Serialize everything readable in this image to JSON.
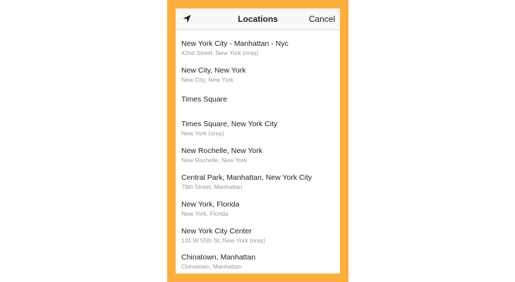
{
  "navbar": {
    "icon": "location-arrow-icon",
    "title": "Locations",
    "cancel_label": "Cancel"
  },
  "locations": [
    {
      "title": "New York City - Manhattan - Nyc",
      "subtitle": "42nd Street, New York (oraș)"
    },
    {
      "title": "New City, New York",
      "subtitle": "New City, New York"
    },
    {
      "title": "Times Square",
      "subtitle": ""
    },
    {
      "title": "Times Square, New York City",
      "subtitle": "New York (oraș)"
    },
    {
      "title": "New Rochelle, New York",
      "subtitle": "New Rochelle, New York"
    },
    {
      "title": "Central Park, Manhattan, New York City",
      "subtitle": "79th Street, Manhattan"
    },
    {
      "title": "New York, Florida",
      "subtitle": "New York, Florida"
    },
    {
      "title": "New York City Center",
      "subtitle": "131 W 55th St, New York (oraș)"
    },
    {
      "title": "Chinatown, Manhattan",
      "subtitle": "Chinatown, Manhattan"
    }
  ],
  "colors": {
    "frame": "#FFAE3B",
    "title_text": "#222222",
    "subtitle_text": "#9a9a9a"
  }
}
